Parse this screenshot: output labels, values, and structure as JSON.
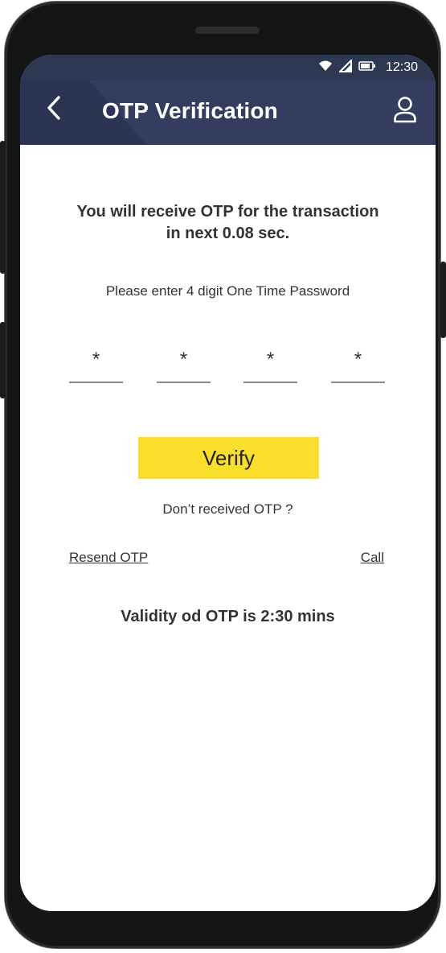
{
  "status_bar": {
    "time": "12:30",
    "icons": [
      "wifi-icon",
      "signal-icon",
      "battery-icon"
    ]
  },
  "header": {
    "title": "OTP Verification",
    "back_icon": "chevron-left-icon",
    "profile_icon": "user-icon"
  },
  "message": {
    "line1": "You will receive OTP for the transaction",
    "line2": "in next 0.08 sec."
  },
  "instruction": "Please enter 4 digit One Time Password",
  "otp_fields": [
    "*",
    "*",
    "*",
    "*"
  ],
  "verify_label": "Verify",
  "not_received": "Don’t received OTP ?",
  "resend_label": "Resend OTP",
  "call_label": "Call",
  "validity": "Validity od OTP is 2:30 mins",
  "colors": {
    "header_bg": "#343d5f",
    "status_bg": "#2f3852",
    "verify_bg": "#fadf2a",
    "text": "#333333"
  }
}
